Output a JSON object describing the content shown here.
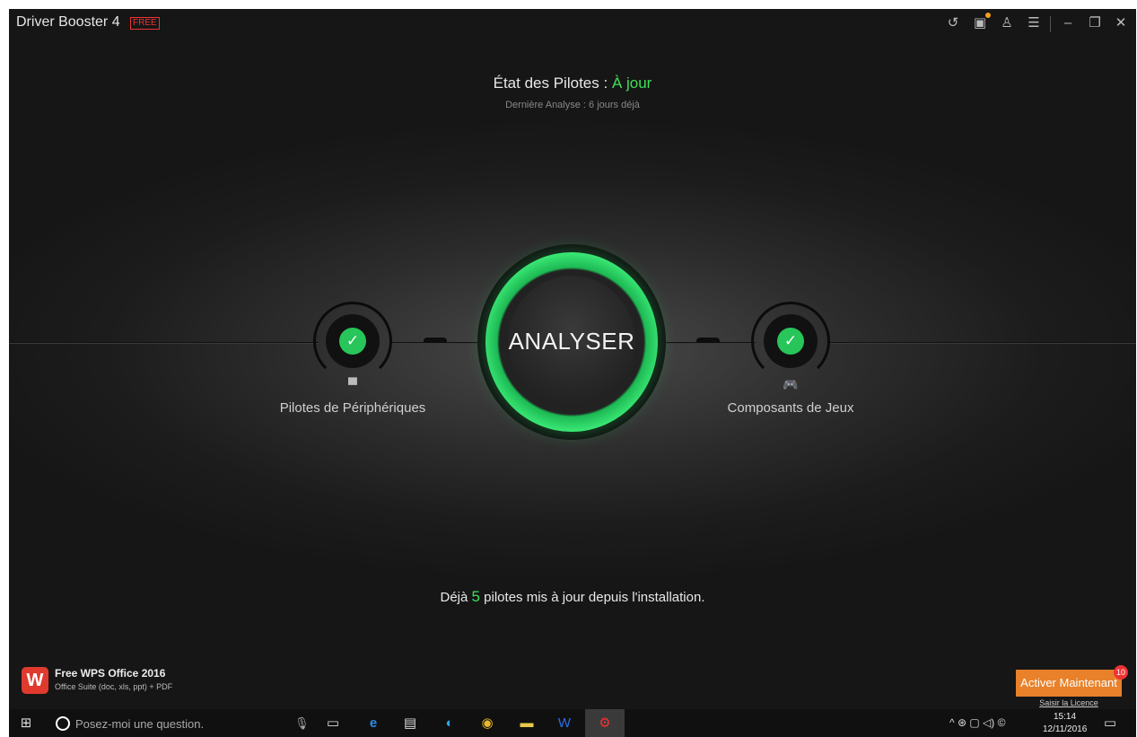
{
  "titlebar": {
    "app_title": "Driver Booster 4",
    "badge": "FREE",
    "icons": [
      "restore-icon",
      "gift-icon",
      "shirt-icon",
      "menu-icon",
      "minimize-icon",
      "maximize-icon",
      "close-icon"
    ]
  },
  "status": {
    "label": "État des Pilotes :",
    "value": "À jour",
    "last_scan": "Dernière Analyse : 6 jours déjà"
  },
  "modules": {
    "devices": {
      "label": "Pilotes de Périphériques",
      "icon": "monitor-icon",
      "state": "ok"
    },
    "games": {
      "label": "Composants de Jeux",
      "icon": "gamepad-icon",
      "state": "ok"
    }
  },
  "scan_button": {
    "label": "ANALYSER"
  },
  "summary": {
    "prefix": "Déjà",
    "count": "5",
    "suffix": "pilotes mis à jour depuis l'installation."
  },
  "promo": {
    "logo_letter": "W",
    "title": "Free WPS Office 2016",
    "description": "Office Suite (doc, xls, ppt) + PDF"
  },
  "activation": {
    "button_label": "Activer Maintenant",
    "badge_count": "10",
    "license_link": "Saisir la Licence"
  },
  "taskbar": {
    "search_placeholder": "Posez-moi une question.",
    "time": "15:14",
    "date": "12/11/2016"
  },
  "colors": {
    "accent_green": "#3fe05a",
    "button_orange": "#e8812a",
    "badge_red": "#e33333"
  }
}
